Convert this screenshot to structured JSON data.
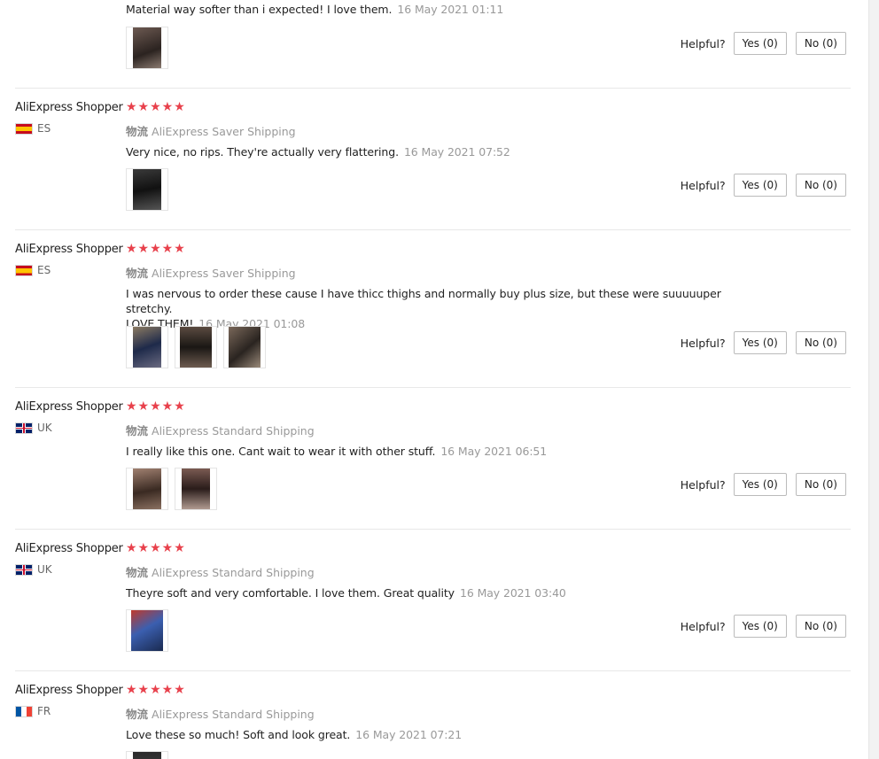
{
  "helpful_label": "Helpful?",
  "reviews": [
    {
      "user": "",
      "country": "",
      "stars": "",
      "shipping_cn": "",
      "shipping": "",
      "text": "Material way softer than i expected! I love them.",
      "date": "16 May 2021 01:11",
      "photos": 1,
      "yes_label": "Yes (0)",
      "no_label": "No (0)"
    },
    {
      "user": "AliExpress Shopper",
      "country": "ES",
      "flag": "flag-es",
      "stars": "★★★★★",
      "shipping_cn": "物流",
      "shipping": "AliExpress Saver Shipping",
      "text": "Very nice, no rips. They're actually very flattering.",
      "date": "16 May 2021 07:52",
      "photos": 1,
      "yes_label": "Yes (0)",
      "no_label": "No (0)"
    },
    {
      "user": "AliExpress Shopper",
      "country": "ES",
      "flag": "flag-es",
      "stars": "★★★★★",
      "shipping_cn": "物流",
      "shipping": "AliExpress Saver Shipping",
      "text": "I was nervous to order these cause I have thicc thighs and normally buy plus size, but these were suuuuuper stretchy.",
      "text2": "LOVE THEM!",
      "date": "16 May 2021 01:08",
      "photos": 3,
      "yes_label": "Yes (0)",
      "no_label": "No (0)"
    },
    {
      "user": "AliExpress Shopper",
      "country": "UK",
      "flag": "flag-uk",
      "stars": "★★★★★",
      "shipping_cn": "物流",
      "shipping": "AliExpress Standard Shipping",
      "text": "I really like this one. Cant wait to wear it with other stuff.",
      "date": "16 May 2021 06:51",
      "photos": 2,
      "yes_label": "Yes (0)",
      "no_label": "No (0)"
    },
    {
      "user": "AliExpress Shopper",
      "country": "UK",
      "flag": "flag-uk",
      "stars": "★★★★★",
      "shipping_cn": "物流",
      "shipping": "AliExpress Standard Shipping",
      "text": "Theyre soft and very comfortable. I love them. Great quality",
      "date": "16 May 2021 03:40",
      "photos": 1,
      "yes_label": "Yes (0)",
      "no_label": "No (0)"
    },
    {
      "user": "AliExpress Shopper",
      "country": "FR",
      "flag": "flag-fr",
      "stars": "★★★★★",
      "shipping_cn": "物流",
      "shipping": "AliExpress Standard Shipping",
      "text": "Love these so much! Soft and look great.",
      "date": "16 May 2021 07:21",
      "photos": 1,
      "yes_label": "",
      "no_label": ""
    }
  ]
}
